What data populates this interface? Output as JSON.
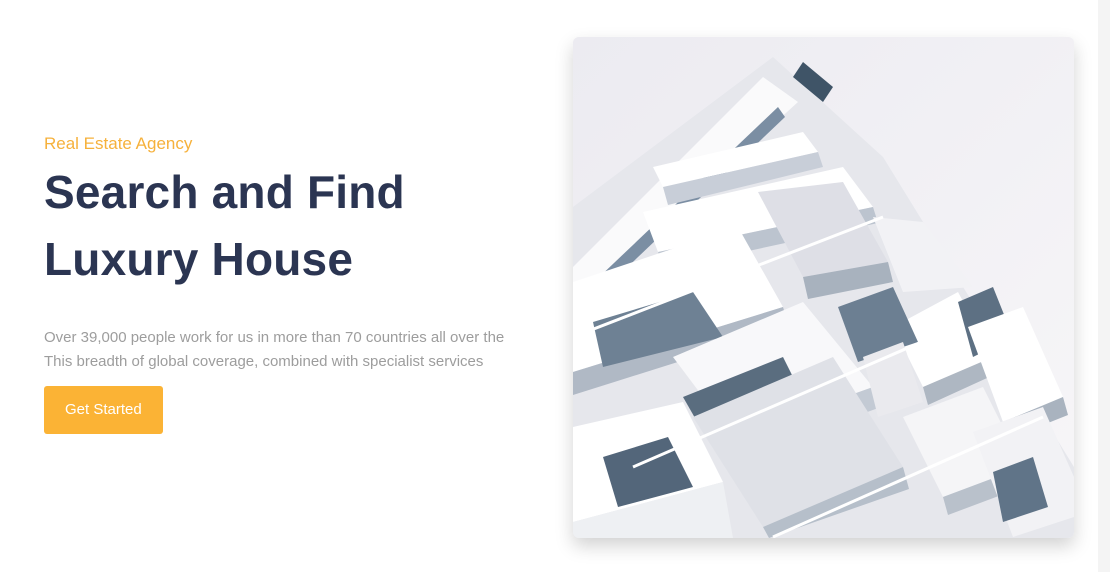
{
  "hero": {
    "eyebrow": "Real Estate Agency",
    "title_line1": "Search and Find",
    "title_line2": "Luxury House",
    "description": "Over 39,000 people work for us in more than 70 countries all over the This breadth of global coverage, combined with specialist services",
    "cta_label": "Get Started"
  },
  "colors": {
    "accent": "#fbb335",
    "heading": "#2b3552",
    "body_text": "#9d9d9d"
  },
  "image": {
    "subject": "modern-white-apartment-building"
  }
}
